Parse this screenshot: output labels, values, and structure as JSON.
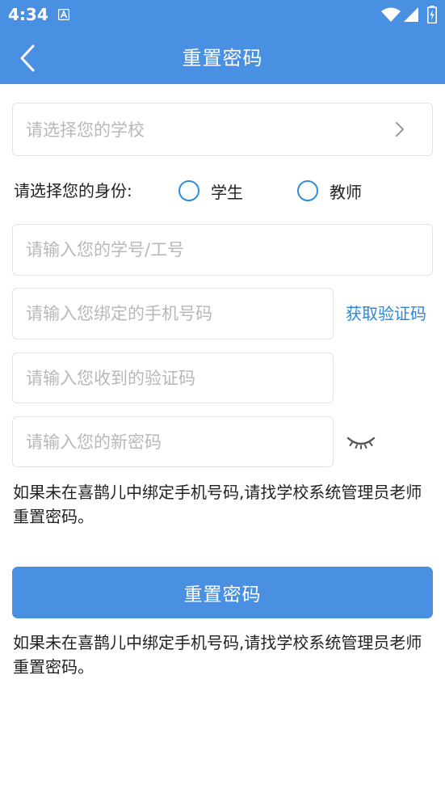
{
  "status_bar": {
    "time": "4:34",
    "notification_icon": "a-letter-icon",
    "wifi_icon": "wifi-icon",
    "signal_icon": "signal-icon",
    "battery_icon": "battery-charging-icon"
  },
  "header": {
    "title": "重置密码",
    "back_icon": "chevron-left-icon"
  },
  "form": {
    "school_placeholder": "请选择您的学校",
    "identity_label": "请选择您的身份:",
    "identity_options": [
      {
        "label": "学生",
        "selected": false
      },
      {
        "label": "教师",
        "selected": false
      }
    ],
    "id_placeholder": "请输入您的学号/工号",
    "phone_placeholder": "请输入您绑定的手机号码",
    "get_code_label": "获取验证码",
    "code_placeholder": "请输入您收到的验证码",
    "password_placeholder": "请输入您的新密码",
    "password_toggle_icon": "eye-closed-icon",
    "notice_text": "如果未在喜鹊儿中绑定手机号码,请找学校系统管理员老师重置密码。",
    "submit_label": "重置密码",
    "footer_notice": "如果未在喜鹊儿中绑定手机号码,请找学校系统管理员老师重置密码。"
  },
  "colors": {
    "primary": "#4a90e2",
    "link": "#2d86db",
    "radio_border": "#2d8ee0",
    "placeholder": "#b8b8b8",
    "border": "#e3e3e3"
  }
}
